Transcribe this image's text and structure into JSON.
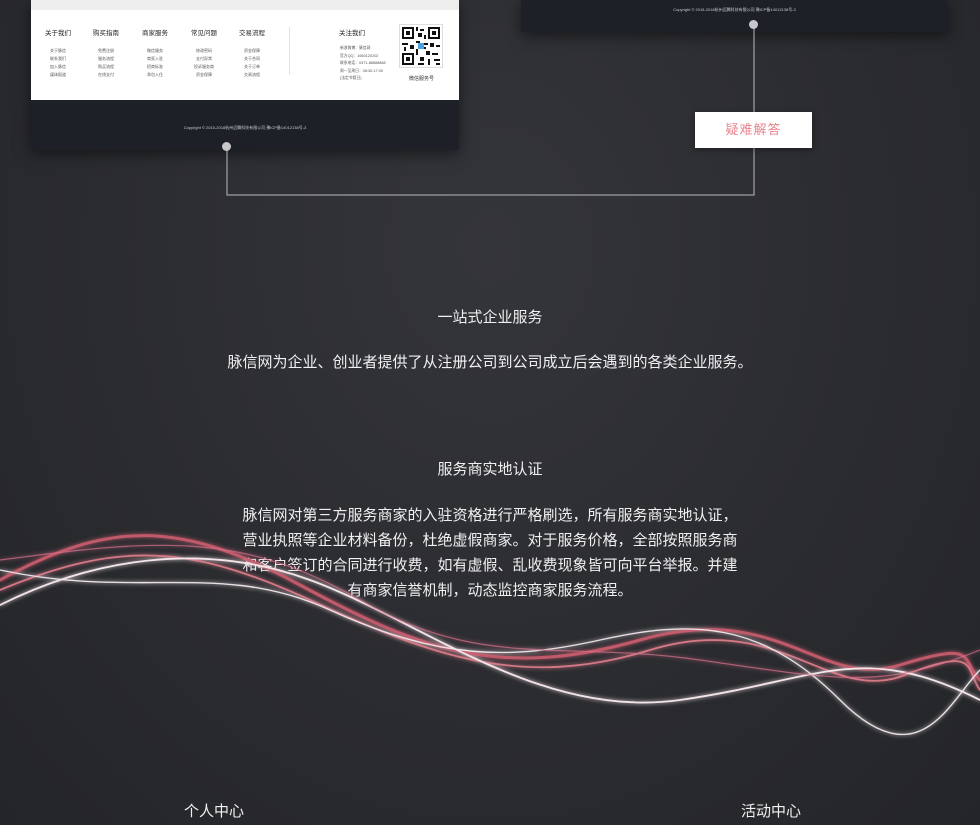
{
  "footer_left": {
    "columns": [
      {
        "heading": "关于我们",
        "items": [
          "关于脉信",
          "联系我们",
          "加入脉信",
          "媒体报道"
        ]
      },
      {
        "heading": "购买指南",
        "items": [
          "免费注册",
          "服务流程",
          "购买流程",
          "在线支付"
        ]
      },
      {
        "heading": "商家服务",
        "items": [
          "微信服务",
          "商家入驻",
          "招商标准",
          "承包入住"
        ]
      },
      {
        "heading": "常见问题",
        "items": [
          "修改密码",
          "支付异常",
          "投诉服务商",
          "资金保障"
        ]
      },
      {
        "heading": "交易流程",
        "items": [
          "资金保障",
          "关于合同",
          "关于订单",
          "交易流程"
        ]
      }
    ],
    "follow_heading": "关注我们",
    "contact_lines": [
      "新浪微博：脉信网",
      "官方QQ：1660120202",
      "联系电话：0371-88888888",
      "周一至周日：08:30-17:00",
      "(法定节假日)"
    ],
    "wechat_label": "微信服务号",
    "copyright": "Copyright © 2015-2018杭州迈腾科技有限公司 豫ICP备14012138号-3"
  },
  "footer_right": {
    "copyright": "Copyright © 2015-2018杭州迈腾科技有限公司 豫ICP备14012138号-3"
  },
  "callout": {
    "label": "疑难解答"
  },
  "section1": {
    "title": "一站式企业服务",
    "text": "脉信网为企业、创业者提供了从注册公司到公司成立后会遇到的各类企业服务。"
  },
  "section2": {
    "title": "服务商实地认证",
    "lines": [
      "脉信网对第三方服务商家的入驻资格进行严格刷选，所有服务商实地认证，",
      "营业执照等企业材料备份，杜绝虚假商家。对于服务价格，全部按照服务商",
      "和客户签订的合同进行收费，如有虚假、乱收费现象皆可向平台举报。并建",
      "有商家信誉机制，动态监控商家服务流程。"
    ]
  },
  "bottom_links": {
    "left": "个人中心",
    "right": "活动中心"
  },
  "colors": {
    "accent_pink": "#e8848e",
    "footer_dark": "#1d2127",
    "page_bg": "#2c2d31"
  }
}
